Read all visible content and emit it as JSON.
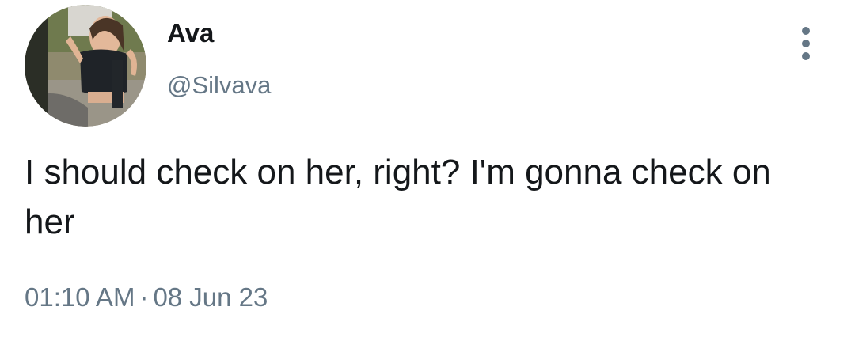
{
  "author": {
    "display_name": "Ava",
    "handle": "@Silvava",
    "avatar_description": "profile photo"
  },
  "tweet": {
    "text": "I should check on her, right? I'm gonna check on her",
    "time": "01:10 AM",
    "separator": "·",
    "date": "08 Jun 23"
  },
  "icons": {
    "more": "more-vertical-icon"
  },
  "colors": {
    "text_primary": "#14171a",
    "text_secondary": "#657786",
    "background": "#ffffff"
  }
}
